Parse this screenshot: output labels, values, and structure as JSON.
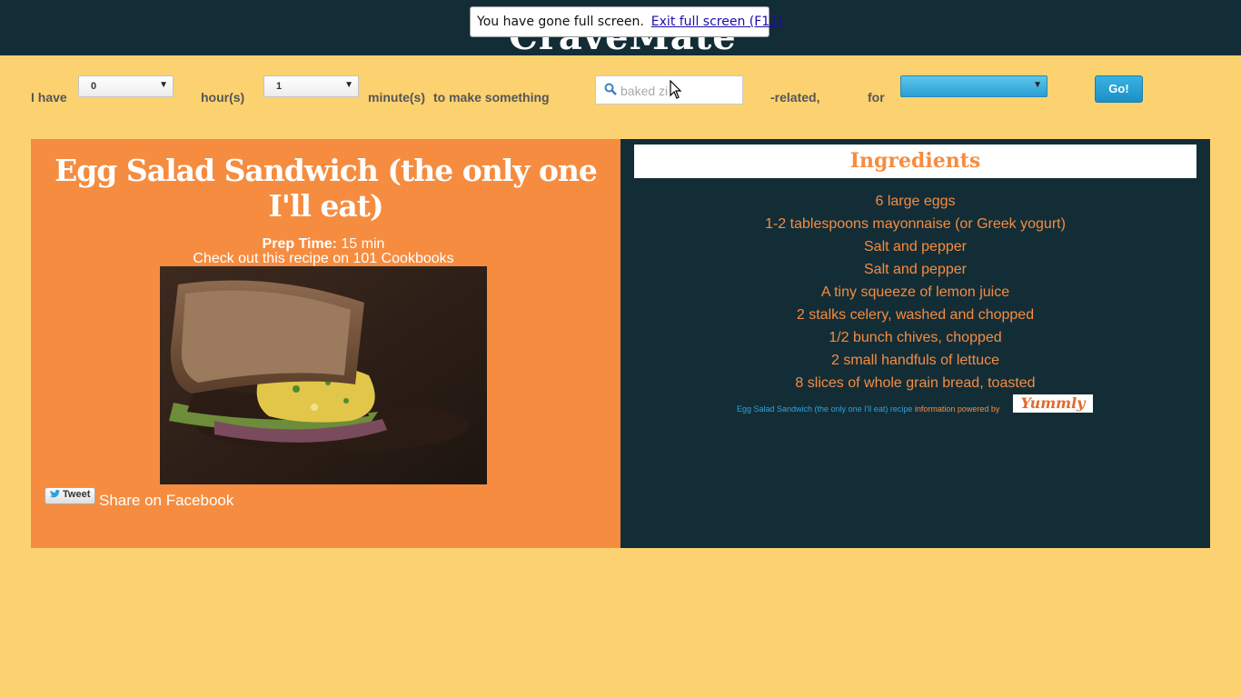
{
  "header": {
    "site_title": "CraveMate"
  },
  "fullscreen_notice": {
    "message": "You have gone full screen.",
    "exit_link": "Exit full screen (F11)"
  },
  "search_form": {
    "i_have_label": "I have",
    "hours_value": "0",
    "hours_label": "hour(s)",
    "minutes_value": "1",
    "minutes_label": "minute(s)",
    "to_make_label": "to make something",
    "keyword_placeholder": "baked zi",
    "related_label": "-related,",
    "for_label": "for",
    "for_value": "",
    "go_label": "Go!"
  },
  "recipe": {
    "title": "Egg Salad Sandwich (the only one I'll eat)",
    "prep_label": "Prep Time:",
    "prep_value": "15 min",
    "source_link": "Check out this recipe on 101 Cookbooks",
    "tweet_label": "Tweet",
    "facebook_link": "Share on Facebook"
  },
  "ingredients": {
    "heading": "Ingredients",
    "items": [
      "6 large eggs",
      "1-2 tablespoons mayonnaise (or Greek yogurt)",
      "Salt and pepper",
      "Salt and pepper",
      "A tiny squeeze of lemon juice",
      "2 stalks celery, washed and chopped",
      "1/2 bunch chives, chopped",
      "2 small handfuls of lettuce",
      "8 slices of whole grain bread, toasted"
    ],
    "attribution_link": "Egg Salad Sandwich (the only one I'll eat) recipe",
    "attribution_text": "information powered by",
    "yummly_logo": "Yummly"
  },
  "colors": {
    "background": "#fcd271",
    "dark_panel": "#132d37",
    "orange_panel": "#f68c40",
    "button_blue": "#2ea3d8"
  },
  "icons": {
    "search": "search-icon",
    "cursor": "mouse-pointer-icon",
    "twitter": "twitter-bird-icon"
  }
}
